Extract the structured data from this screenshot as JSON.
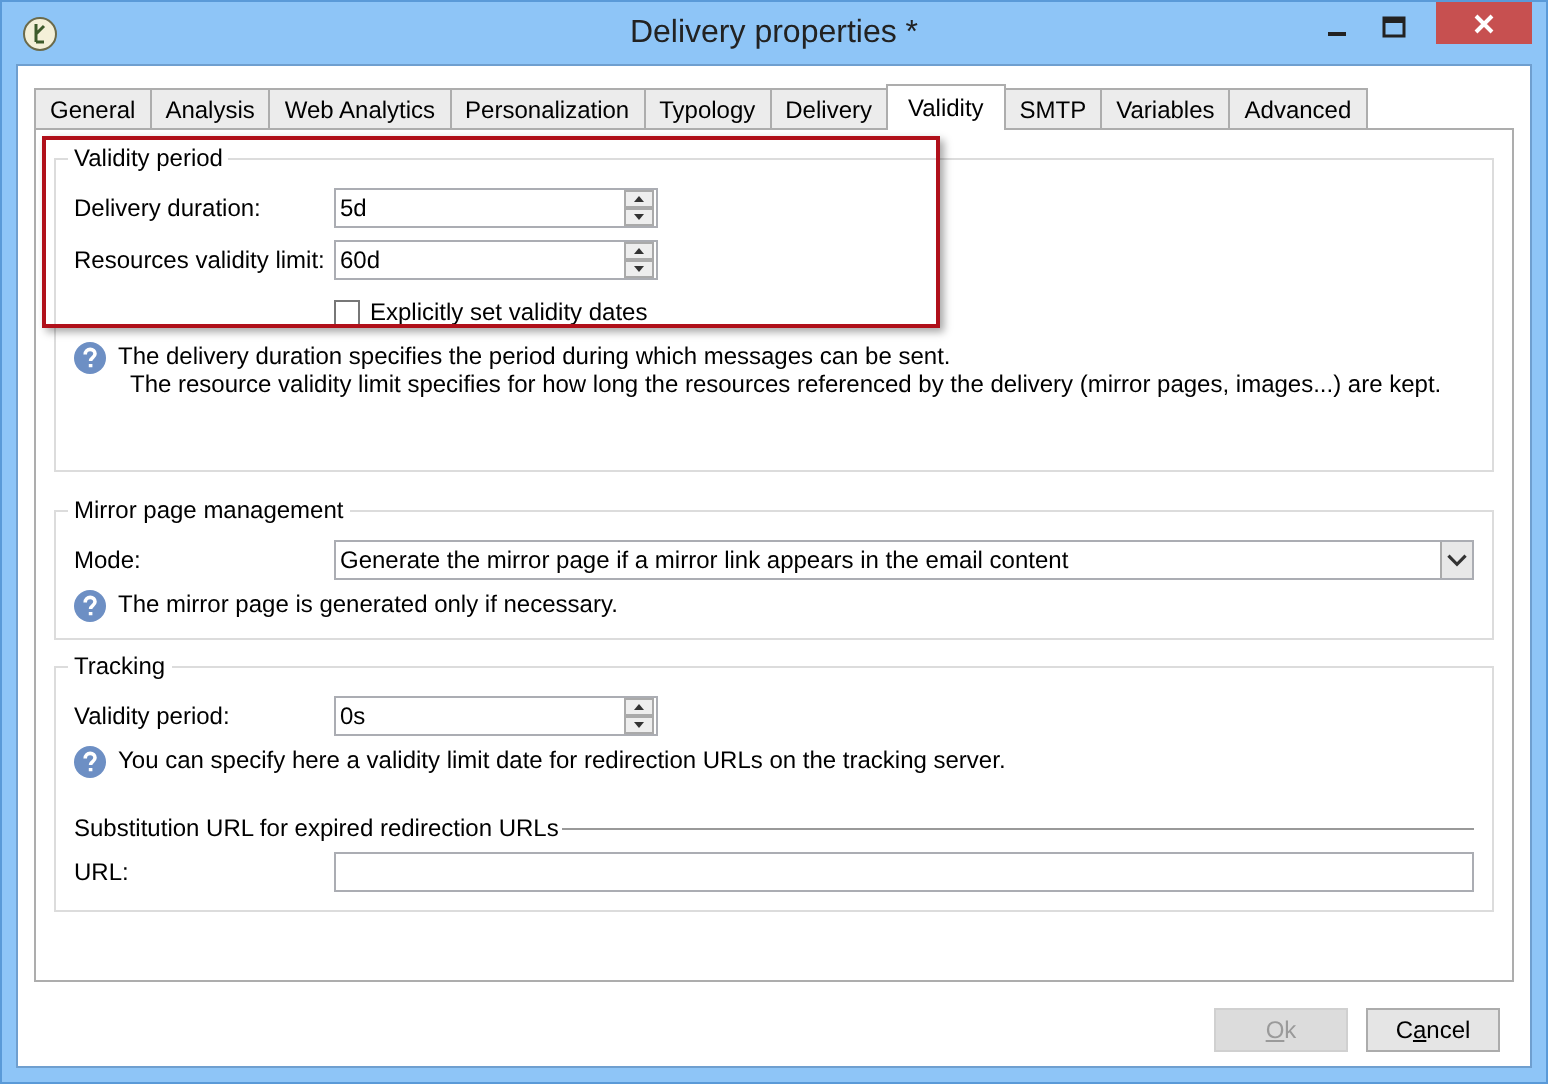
{
  "window": {
    "title": "Delivery properties *"
  },
  "tabs": [
    {
      "label": "General",
      "selected": false
    },
    {
      "label": "Analysis",
      "selected": false
    },
    {
      "label": "Web Analytics",
      "selected": false
    },
    {
      "label": "Personalization",
      "selected": false
    },
    {
      "label": "Typology",
      "selected": false
    },
    {
      "label": "Delivery",
      "selected": false
    },
    {
      "label": "Validity",
      "selected": true
    },
    {
      "label": "SMTP",
      "selected": false
    },
    {
      "label": "Variables",
      "selected": false
    },
    {
      "label": "Advanced",
      "selected": false
    }
  ],
  "validity_period": {
    "legend": "Validity period",
    "highlighted": true,
    "fields": [
      {
        "label": "Delivery duration:",
        "value": "5d"
      },
      {
        "label": "Resources validity limit:",
        "value": "60d"
      }
    ],
    "checkbox": {
      "label": "Explicitly set validity dates",
      "checked": false
    },
    "help": [
      "The delivery duration specifies the period during which messages can be sent.",
      "The resource validity limit specifies for how long the resources referenced by the delivery (mirror pages, images...) are kept."
    ]
  },
  "mirror_page": {
    "legend": "Mirror page management",
    "mode_label": "Mode:",
    "mode_value": "Generate the mirror page if a mirror link appears in the email content",
    "help": "The mirror page is generated only if necessary."
  },
  "tracking": {
    "legend": "Tracking",
    "field": {
      "label": "Validity period:",
      "value": "0s"
    },
    "help": "You can specify here a validity limit date for redirection URLs on the tracking server.",
    "substitution_heading": "Substitution URL for expired redirection URLs",
    "url_label": "URL:"
  },
  "buttons": [
    {
      "label": "Ok",
      "disabled": true
    },
    {
      "label": "Cancel",
      "disabled": false
    }
  ]
}
